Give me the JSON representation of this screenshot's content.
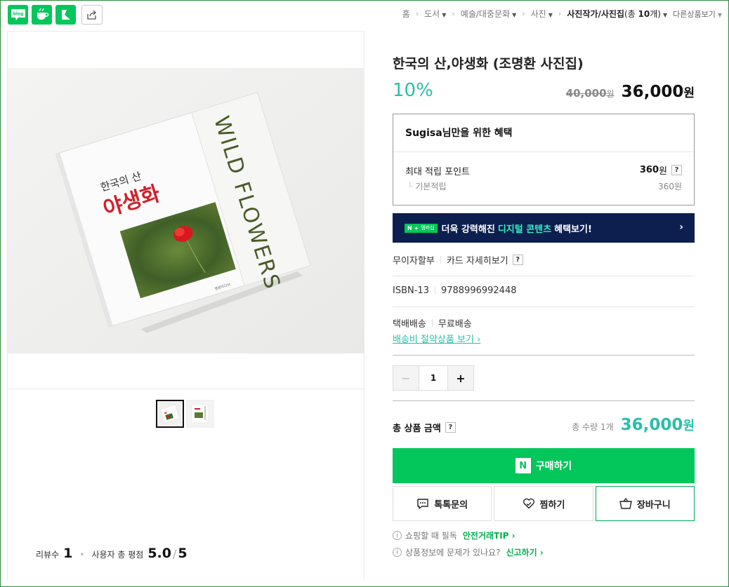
{
  "share": {
    "blog_label": "blog",
    "cafe_label": "cafe",
    "keep_label": "keep",
    "share_label": "share"
  },
  "breadcrumb": {
    "items": [
      "홈",
      "도서",
      "예술/대중문화",
      "사진"
    ],
    "current": "사진작가/사진집",
    "current_count_prefix": "(총 ",
    "current_count": "10",
    "current_count_suffix": "개)",
    "more": "다른상품보기"
  },
  "product": {
    "title": "한국의 산,야생화 (조명환 사진집)",
    "discount": "10%",
    "original_price": "40,000",
    "original_unit": "원",
    "sale_price": "36,000",
    "sale_unit": "원"
  },
  "cover": {
    "title_small": "한국의 산",
    "title_big": "야생화",
    "spine": "WILD FLOWERS",
    "publisher": "명원미디어"
  },
  "benefit": {
    "title_user": "Sugisa",
    "title_rest": "님만을 위한 혜택",
    "max_points_label": "최대 적립 포인트",
    "max_points_value": "360",
    "max_points_unit": "원",
    "qmark": "?",
    "base_label": "기본적립",
    "base_value": "360원"
  },
  "banner": {
    "badge_n": "N +",
    "badge_text": "멤버십",
    "text_before": "더욱 강력해진",
    "highlight": "디지털 콘텐츠",
    "text_after": "혜택보기!",
    "chevron": "›"
  },
  "info": {
    "installment_label": "무이자할부",
    "installment_link": "카드 자세히보기",
    "qmark": "?",
    "isbn_label": "ISBN-13",
    "isbn_value": "9788996992448",
    "shipping_label": "택배배송",
    "shipping_value": "무료배송",
    "shipping_link": "배송비 절약상품 보기 ›"
  },
  "quantity": {
    "minus": "−",
    "value": "1",
    "plus": "+"
  },
  "total": {
    "label": "총 상품 금액",
    "qmark": "?",
    "count_text": "총 수량 1개",
    "value": "36,000",
    "unit": "원"
  },
  "actions": {
    "buy_logo": "N",
    "buy_label": "구매하기",
    "talk_label": "톡톡문의",
    "wish_label": "찜하기",
    "cart_label": "장바구니"
  },
  "notices": {
    "n1_text": "쇼핑할 때 필독",
    "n1_link": "안전거래TIP ›",
    "n2_text": "상품정보에 문제가 있나요?",
    "n2_link": "신고하기 ›",
    "info_glyph": "i"
  },
  "review": {
    "count_label": "리뷰수",
    "count_value": "1",
    "rating_label": "사용자 총 평점",
    "rating_value": "5.0",
    "rating_max": "5"
  },
  "colors": {
    "naver_green": "#03c75a",
    "accent_teal": "#2abfa8",
    "banner_navy": "#0d1f4f"
  }
}
